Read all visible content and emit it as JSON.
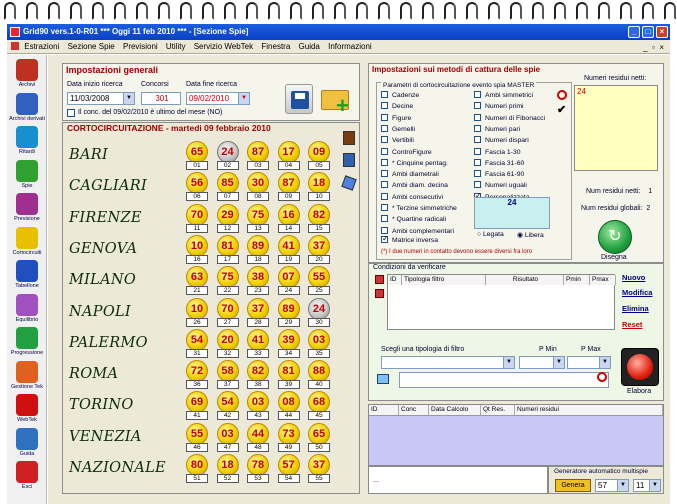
{
  "window": {
    "title": "Grid90 vers.1-0-R01  ***  Oggi 11 feb 2010  ***  - [Sezione Spie]"
  },
  "menu": [
    "Estrazioni",
    "Sezione Spie",
    "Previsioni",
    "Utility",
    "Servizio WebTek",
    "Finestra",
    "Guida",
    "Informazioni"
  ],
  "sidebar": [
    {
      "label": "Archivi",
      "icon": "pencil-icon",
      "color": "#c03020"
    },
    {
      "label": "Archivi derivati",
      "icon": "archive-icon",
      "color": "#3060c0"
    },
    {
      "label": "Ritardi",
      "icon": "clock-icon",
      "color": "#1890d0"
    },
    {
      "label": "Spie",
      "icon": "magnifier-icon",
      "color": "#30a030"
    },
    {
      "label": "Previsione",
      "icon": "checklist-icon",
      "color": "#a03090"
    },
    {
      "label": "Cortocircuiti",
      "icon": "lightbulb-icon",
      "color": "#e8c000"
    },
    {
      "label": "Tabellone",
      "icon": "calendar-icon",
      "color": "#2050c0"
    },
    {
      "label": "Equilibrio",
      "icon": "balance-icon",
      "color": "#a050c0"
    },
    {
      "label": "Progressione",
      "icon": "dollar-icon",
      "color": "#20a040"
    },
    {
      "label": "Gestione Tek",
      "icon": "tools-icon",
      "color": "#e06020"
    },
    {
      "label": "WebTek",
      "icon": "a-letter-icon",
      "color": "#d01010"
    },
    {
      "label": "Guida",
      "icon": "book-icon",
      "color": "#3070c0"
    },
    {
      "label": "Esci",
      "icon": "power-icon",
      "color": "#d02020"
    }
  ],
  "general": {
    "title": "Impostazioni generali",
    "start_label": "Data inizio ricerca",
    "start_value": "11/03/2008",
    "concorsi_label": "Concorsi",
    "concorsi_value": "301",
    "end_label": "Data fine ricerca",
    "end_value": "09/02/2010",
    "note": "Il conc. del 09/02/2010 è ultimo del mese (NO)"
  },
  "draw": {
    "title": "CORTOCIRCUITAZIONE - martedi 09 febbraio 2010",
    "wheels": [
      {
        "name": "BARI",
        "balls": [
          {
            "n": "65",
            "i": "01"
          },
          {
            "n": "24",
            "i": "02",
            "gray": true
          },
          {
            "n": "87",
            "i": "03"
          },
          {
            "n": "17",
            "i": "04"
          },
          {
            "n": "09",
            "i": "05"
          }
        ]
      },
      {
        "name": "CAGLIARI",
        "balls": [
          {
            "n": "56",
            "i": "06"
          },
          {
            "n": "85",
            "i": "07"
          },
          {
            "n": "30",
            "i": "08"
          },
          {
            "n": "87",
            "i": "09"
          },
          {
            "n": "18",
            "i": "10"
          }
        ]
      },
      {
        "name": "FIRENZE",
        "balls": [
          {
            "n": "70",
            "i": "11"
          },
          {
            "n": "29",
            "i": "12"
          },
          {
            "n": "75",
            "i": "13"
          },
          {
            "n": "16",
            "i": "14"
          },
          {
            "n": "82",
            "i": "15"
          }
        ]
      },
      {
        "name": "GENOVA",
        "balls": [
          {
            "n": "10",
            "i": "16"
          },
          {
            "n": "81",
            "i": "17"
          },
          {
            "n": "89",
            "i": "18"
          },
          {
            "n": "41",
            "i": "19"
          },
          {
            "n": "37",
            "i": "20"
          }
        ]
      },
      {
        "name": "MILANO",
        "balls": [
          {
            "n": "63",
            "i": "21"
          },
          {
            "n": "75",
            "i": "22"
          },
          {
            "n": "38",
            "i": "23"
          },
          {
            "n": "07",
            "i": "24"
          },
          {
            "n": "55",
            "i": "25"
          }
        ]
      },
      {
        "name": "NAPOLI",
        "balls": [
          {
            "n": "10",
            "i": "26"
          },
          {
            "n": "70",
            "i": "27"
          },
          {
            "n": "37",
            "i": "28"
          },
          {
            "n": "89",
            "i": "29"
          },
          {
            "n": "24",
            "i": "30",
            "gray": true
          }
        ]
      },
      {
        "name": "PALERMO",
        "balls": [
          {
            "n": "54",
            "i": "31"
          },
          {
            "n": "20",
            "i": "32"
          },
          {
            "n": "41",
            "i": "33"
          },
          {
            "n": "39",
            "i": "34"
          },
          {
            "n": "03",
            "i": "35"
          }
        ]
      },
      {
        "name": "ROMA",
        "balls": [
          {
            "n": "72",
            "i": "36"
          },
          {
            "n": "58",
            "i": "37"
          },
          {
            "n": "82",
            "i": "38"
          },
          {
            "n": "81",
            "i": "39"
          },
          {
            "n": "88",
            "i": "40"
          }
        ]
      },
      {
        "name": "TORINO",
        "balls": [
          {
            "n": "69",
            "i": "41"
          },
          {
            "n": "54",
            "i": "42"
          },
          {
            "n": "03",
            "i": "43"
          },
          {
            "n": "08",
            "i": "44"
          },
          {
            "n": "68",
            "i": "45"
          }
        ]
      },
      {
        "name": "VENEZIA",
        "balls": [
          {
            "n": "55",
            "i": "46"
          },
          {
            "n": "03",
            "i": "47"
          },
          {
            "n": "44",
            "i": "48"
          },
          {
            "n": "73",
            "i": "49"
          },
          {
            "n": "65",
            "i": "50"
          }
        ]
      },
      {
        "name": "NAZIONALE",
        "balls": [
          {
            "n": "80",
            "i": "51"
          },
          {
            "n": "18",
            "i": "52"
          },
          {
            "n": "78",
            "i": "53"
          },
          {
            "n": "57",
            "i": "54"
          },
          {
            "n": "37",
            "i": "55"
          }
        ]
      }
    ]
  },
  "spie": {
    "title": "Impostazioni sui metodi di cattura delle spie",
    "param_title": "Parametri di cortocircuitazione evento spia MASTER",
    "col1": [
      {
        "label": "Cadenze",
        "checked": false
      },
      {
        "label": "Decine",
        "checked": false
      },
      {
        "label": "Figure",
        "checked": false
      },
      {
        "label": "Gemelli",
        "checked": false
      },
      {
        "label": "Vertibili",
        "checked": false
      },
      {
        "label": "ControFigure",
        "checked": false
      },
      {
        "label": "* Cinquine pentag.",
        "checked": false
      },
      {
        "label": "Ambi diametrali",
        "checked": false
      },
      {
        "label": "Ambi diam. decina",
        "checked": false
      },
      {
        "label": "Ambi consecutivi",
        "checked": false
      },
      {
        "label": "* Terzine simmetriche",
        "checked": false
      },
      {
        "label": "* Quartine radicali",
        "checked": false
      },
      {
        "label": "Ambi complementari",
        "checked": false
      }
    ],
    "col2": [
      {
        "label": "Ambi simmetrici",
        "checked": false
      },
      {
        "label": "Numeri primi",
        "checked": false
      },
      {
        "label": "Numeri di Fibonacci",
        "checked": false
      },
      {
        "label": "Numeri pari",
        "checked": false
      },
      {
        "label": "Numeri dispari",
        "checked": false
      },
      {
        "label": "Fascia 1-30",
        "checked": false
      },
      {
        "label": "Fascia 31-60",
        "checked": false
      },
      {
        "label": "Fascia 61-90",
        "checked": false
      },
      {
        "label": "Numeri uguali",
        "checked": false
      },
      {
        "label": "Personalizzata",
        "checked": true
      }
    ],
    "custom_value": "24",
    "legata": "Legata",
    "libera": "Libera",
    "matrice": "Matrice inversa",
    "note": "(*) I due numeri in contatto devono essere diversi fra loro",
    "numres_title": "Numeri residui netti:",
    "numres_value": "24",
    "netti_label": "Num residui netti:",
    "netti_value": "1",
    "globali_label": "Num residui globali:",
    "globali_value": "2",
    "disegna": "Disegna"
  },
  "conditions": {
    "title": "Condizioni da verificare",
    "headers": [
      "ID",
      "Tipologia filtro",
      "Risultato",
      "Pmin",
      "Pmax"
    ],
    "links": [
      "Nuovo",
      "Modifica",
      "Elimina",
      "Reset"
    ],
    "filter_label": "Scegli una tipologia di filtro",
    "pmin_label": "P Min",
    "pmax_label": "P Max",
    "elabora": "Elabora"
  },
  "results": {
    "headers": [
      "ID",
      "Conc",
      "Data Calcolo",
      "Qt Res.",
      "Numeri residui"
    ],
    "footer": "..."
  },
  "generator": {
    "title": "Generatore automatico multispie",
    "button": "Genera",
    "v1": "57",
    "v2": "11"
  }
}
